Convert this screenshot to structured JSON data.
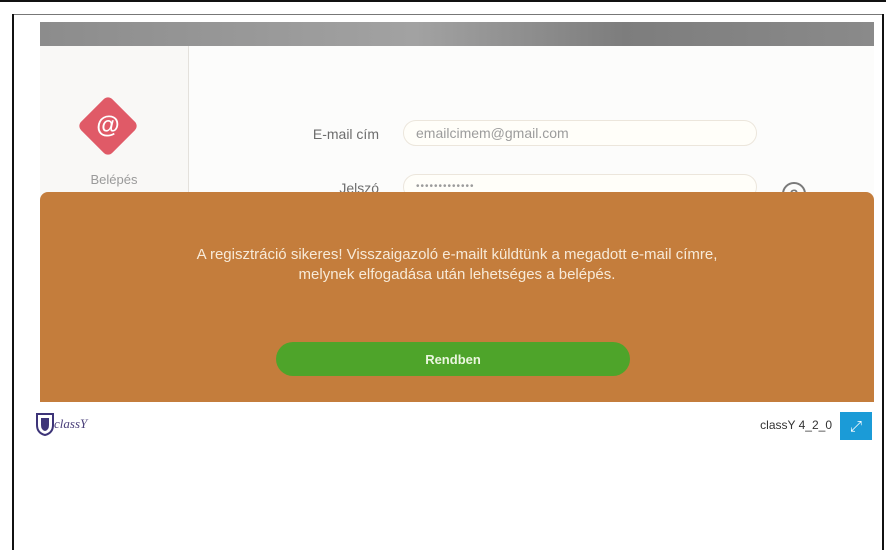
{
  "login_panel": {
    "icon": "at-icon",
    "icon_glyph": "@",
    "label": "Belépés"
  },
  "form": {
    "email_label": "E-mail cím",
    "email_value": "emailcimem@gmail.com",
    "password_label": "Jelszó",
    "password_value": "•••••••••••••"
  },
  "help_icon": {
    "icon": "help-icon",
    "glyph": "?"
  },
  "dialog": {
    "message_line1": "A regisztráció sikeres! Visszaigazoló e-mailt küldtünk a megadott e-mail címre,",
    "message_line2": "melynek elfogadása után lehetséges a belépés.",
    "ok_label": "Rendben",
    "background_color": "#c47d3c",
    "button_color": "#4ea42a"
  },
  "footer": {
    "logo_text": "classY",
    "version": "classY 4_2_0",
    "expand_icon": "expand-icon",
    "expand_glyph": "⤢"
  }
}
